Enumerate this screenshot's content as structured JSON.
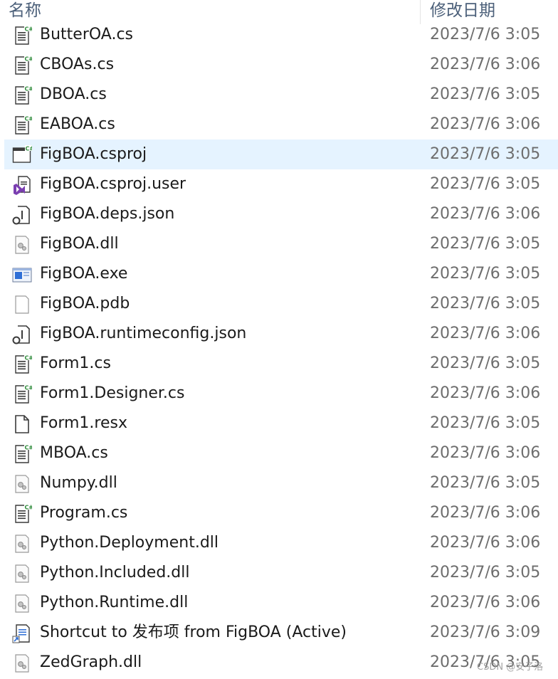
{
  "header": {
    "name": "名称",
    "date_modified": "修改日期"
  },
  "files": [
    {
      "name": "ButterOA.cs",
      "date": "2023/7/6 3:05",
      "icon": "csharp-file-icon"
    },
    {
      "name": "CBOAs.cs",
      "date": "2023/7/6 3:06",
      "icon": "csharp-file-icon"
    },
    {
      "name": "DBOA.cs",
      "date": "2023/7/6 3:05",
      "icon": "csharp-file-icon"
    },
    {
      "name": "EABOA.cs",
      "date": "2023/7/6 3:06",
      "icon": "csharp-file-icon"
    },
    {
      "name": "FigBOA.csproj",
      "date": "2023/7/6 3:05",
      "icon": "csproj-file-icon",
      "selected": true
    },
    {
      "name": "FigBOA.csproj.user",
      "date": "2023/7/6 3:05",
      "icon": "visual-studio-user-icon"
    },
    {
      "name": "FigBOA.deps.json",
      "date": "2023/7/6 3:06",
      "icon": "json-file-icon"
    },
    {
      "name": "FigBOA.dll",
      "date": "2023/7/6 3:05",
      "icon": "dll-file-icon"
    },
    {
      "name": "FigBOA.exe",
      "date": "2023/7/6 3:05",
      "icon": "exe-file-icon"
    },
    {
      "name": "FigBOA.pdb",
      "date": "2023/7/6 3:05",
      "icon": "blank-file-icon"
    },
    {
      "name": "FigBOA.runtimeconfig.json",
      "date": "2023/7/6 3:06",
      "icon": "json-file-icon"
    },
    {
      "name": "Form1.cs",
      "date": "2023/7/6 3:05",
      "icon": "csharp-file-icon"
    },
    {
      "name": "Form1.Designer.cs",
      "date": "2023/7/6 3:06",
      "icon": "csharp-file-icon"
    },
    {
      "name": "Form1.resx",
      "date": "2023/7/6 3:05",
      "icon": "resx-file-icon"
    },
    {
      "name": "MBOA.cs",
      "date": "2023/7/6 3:06",
      "icon": "csharp-file-icon"
    },
    {
      "name": "Numpy.dll",
      "date": "2023/7/6 3:05",
      "icon": "dll-file-icon"
    },
    {
      "name": "Program.cs",
      "date": "2023/7/6 3:06",
      "icon": "csharp-file-icon"
    },
    {
      "name": "Python.Deployment.dll",
      "date": "2023/7/6 3:06",
      "icon": "dll-file-icon"
    },
    {
      "name": "Python.Included.dll",
      "date": "2023/7/6 3:05",
      "icon": "dll-file-icon"
    },
    {
      "name": "Python.Runtime.dll",
      "date": "2023/7/6 3:06",
      "icon": "dll-file-icon"
    },
    {
      "name": "Shortcut to 发布项 from FigBOA (Active)",
      "date": "2023/7/6 3:09",
      "icon": "shortcut-file-icon"
    },
    {
      "name": "ZedGraph.dll",
      "date": "2023/7/6 3:05",
      "icon": "dll-file-icon"
    }
  ],
  "watermark": "CSDN @安子洛"
}
